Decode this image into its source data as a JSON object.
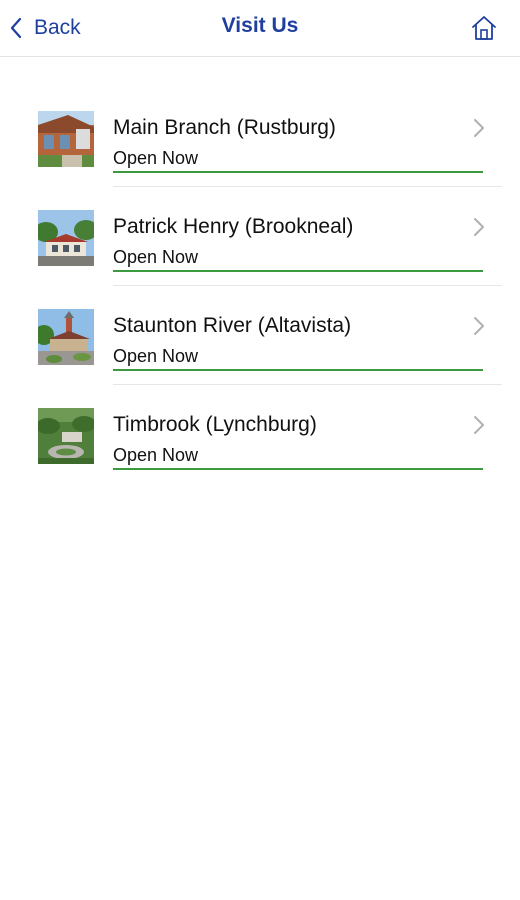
{
  "header": {
    "back_label": "Back",
    "title": "Visit Us",
    "home_icon": "home-icon",
    "accent_color": "#1f3f9e"
  },
  "branches": [
    {
      "name": "Main Branch (Rustburg)",
      "status": "Open Now",
      "status_color": "#3e9a3e",
      "image": "main-branch-photo"
    },
    {
      "name": "Patrick Henry (Brookneal)",
      "status": "Open Now",
      "status_color": "#3e9a3e",
      "image": "patrick-henry-photo"
    },
    {
      "name": "Staunton River (Altavista)",
      "status": "Open Now",
      "status_color": "#3e9a3e",
      "image": "staunton-river-photo"
    },
    {
      "name": "Timbrook (Lynchburg)",
      "status": "Open Now",
      "status_color": "#3e9a3e",
      "image": "timbrook-photo"
    }
  ]
}
